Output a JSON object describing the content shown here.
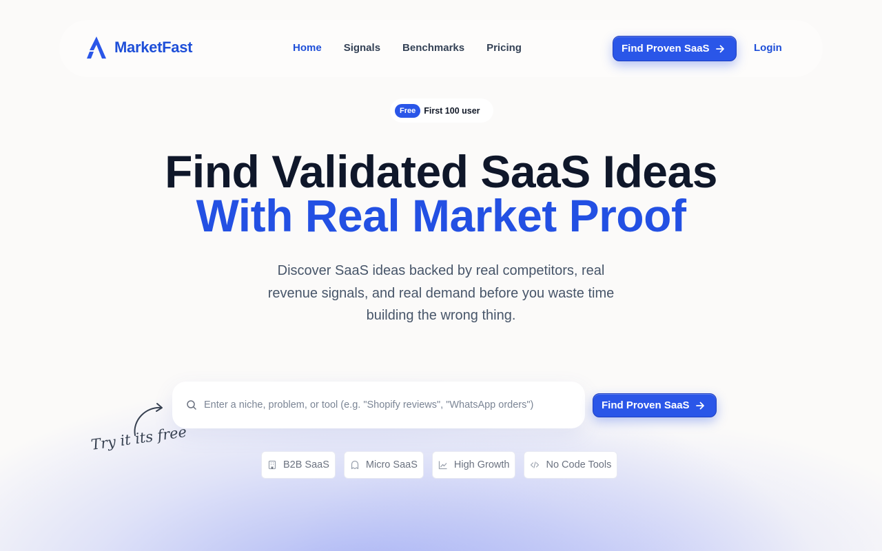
{
  "brand": {
    "name": "MarketFast",
    "color": "#1e4fd8"
  },
  "nav": {
    "links": [
      {
        "label": "Home",
        "active": true
      },
      {
        "label": "Signals",
        "active": false
      },
      {
        "label": "Benchmarks",
        "active": false
      },
      {
        "label": "Pricing",
        "active": false
      }
    ],
    "cta_label": "Find Proven SaaS",
    "login_label": "Login"
  },
  "badge": {
    "tag": "Free",
    "text": "First 100 user"
  },
  "hero": {
    "title_line1": "Find Validated SaaS Ideas",
    "title_line2": "With Real Market Proof",
    "subtitle": "Discover SaaS ideas backed by real competitors, real revenue signals, and real demand before you waste time building the wrong thing."
  },
  "search": {
    "placeholder": "Enter a niche, problem, or tool (e.g. \"Shopify reviews\", \"WhatsApp orders\")",
    "value": "",
    "cta_label": "Find Proven SaaS",
    "icon": "search-icon"
  },
  "hint": {
    "text": "Try it its free",
    "icon": "curved-arrow-icon"
  },
  "chips": [
    {
      "label": "B2B SaaS",
      "icon": "building-icon"
    },
    {
      "label": "Micro SaaS",
      "icon": "ghost-icon"
    },
    {
      "label": "High Growth",
      "icon": "chart-line-icon"
    },
    {
      "label": "No Code Tools",
      "icon": "code-icon"
    }
  ],
  "colors": {
    "accent": "#2a56e8",
    "accent_text": "#2350e3",
    "heading": "#0f172a",
    "muted": "#475569"
  }
}
